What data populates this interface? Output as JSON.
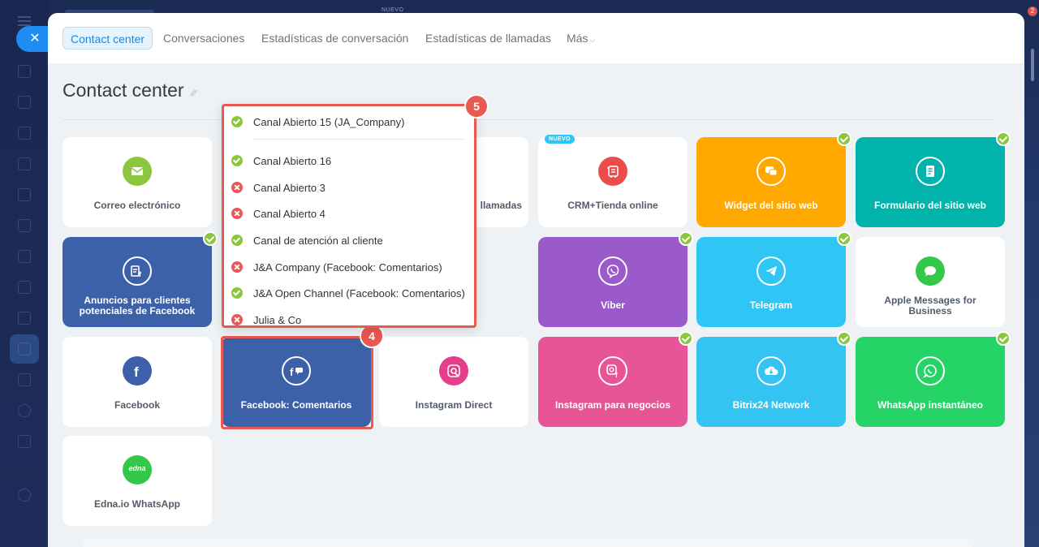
{
  "window": {
    "nuevo_top": "NUEVO",
    "notification_count": "2"
  },
  "tabs": [
    {
      "label": "Contact center"
    },
    {
      "label": "Conversaciones"
    },
    {
      "label": "Estadísticas de conversación"
    },
    {
      "label": "Estadísticas de llamadas"
    },
    {
      "label": "Más"
    }
  ],
  "page": {
    "title": "Contact center"
  },
  "tiles": {
    "email": {
      "label": "Correo electrónico",
      "color": "#8cc63f"
    },
    "calls": {
      "label": "llamadas"
    },
    "crm_store": {
      "label": "CRM+Tienda online",
      "badge": "NUEVO",
      "color": "#ee4b4b"
    },
    "widget": {
      "label": "Widget del sitio web",
      "color": "#ffa900"
    },
    "web_form": {
      "label": "Formulario del sitio web",
      "color": "#00b4ac"
    },
    "fb_leads": {
      "label": "Anuncios para clientes potenciales de Facebook",
      "color": "#3d61a8"
    },
    "viber": {
      "label": "Viber",
      "color": "#9a5ac9"
    },
    "telegram": {
      "label": "Telegram",
      "color": "#2fc6f6"
    },
    "apple": {
      "label": "Apple Messages for Business",
      "color": "#34c84a"
    },
    "facebook": {
      "label": "Facebook",
      "color": "#3d61a8"
    },
    "fb_comments": {
      "label": "Facebook: Comentarios",
      "color": "#3d61a8"
    },
    "instagram_direct": {
      "label": "Instagram Direct",
      "color": "#e53e8c"
    },
    "instagram_business": {
      "label": "Instagram para negocios",
      "color": "#e85596"
    },
    "bitrix_network": {
      "label": "Bitrix24 Network",
      "color": "#34c4f2"
    },
    "whatsapp": {
      "label": "WhatsApp instantáneo",
      "color": "#25d366"
    },
    "edna": {
      "label": "Edna.io WhatsApp",
      "logo_text": "edna",
      "color": "#34c84a"
    }
  },
  "dropdown": {
    "items": [
      {
        "label": "Canal Abierto 15 (JA_Company)",
        "status": "ok"
      },
      {
        "label": "Canal Abierto 16",
        "status": "ok"
      },
      {
        "label": "Canal Abierto 3",
        "status": "error"
      },
      {
        "label": "Canal Abierto 4",
        "status": "error"
      },
      {
        "label": "Canal de atención al cliente",
        "status": "ok"
      },
      {
        "label": "J&A Company (Facebook: Comentarios)",
        "status": "error"
      },
      {
        "label": "J&A Open Channel (Facebook: Comentarios)",
        "status": "ok"
      },
      {
        "label": "Julia & Co",
        "status": "error"
      }
    ]
  },
  "annotations": {
    "step4": "4",
    "step5": "5",
    "color": "#e8594f"
  }
}
